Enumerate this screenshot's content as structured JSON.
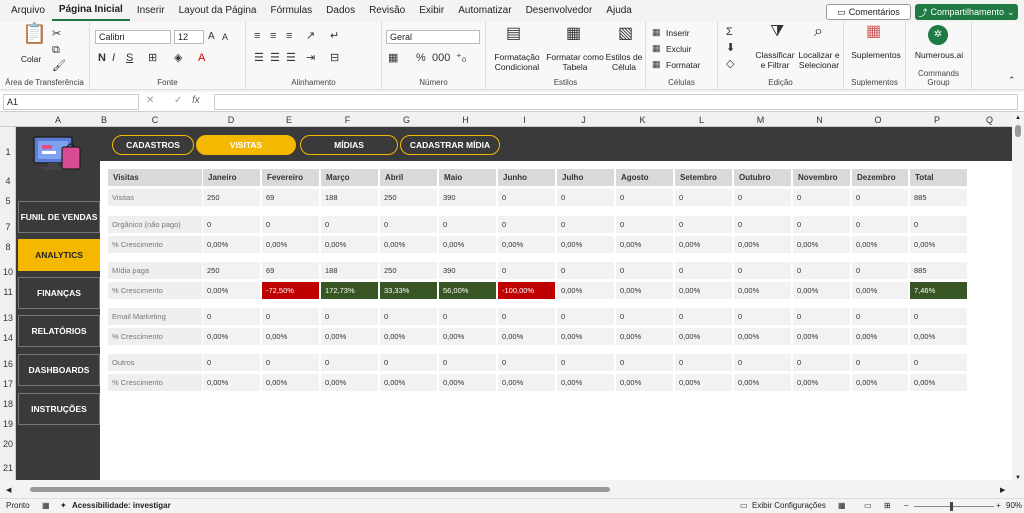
{
  "menu": [
    "Arquivo",
    "Página Inicial",
    "Inserir",
    "Layout da Página",
    "Fórmulas",
    "Dados",
    "Revisão",
    "Exibir",
    "Automatizar",
    "Desenvolvedor",
    "Ajuda"
  ],
  "top_buttons": {
    "comments": "Comentários",
    "share": "Compartilhamento"
  },
  "ribbon": {
    "clipboard": {
      "paste": "Colar",
      "label": "Área de Transferência"
    },
    "font": {
      "name": "Calibri",
      "size": "12",
      "label": "Fonte"
    },
    "alignment": {
      "label": "Alinhamento"
    },
    "number": {
      "format": "Geral",
      "label": "Número"
    },
    "styles": {
      "conditional": "Formatação Condicional",
      "table": "Formatar como Tabela",
      "cell": "Estilos de Célula",
      "label": "Estilos"
    },
    "cells": {
      "insert": "Inserir",
      "delete": "Excluir",
      "format": "Formatar",
      "label": "Células"
    },
    "editing": {
      "sort": "Classificar e Filtrar",
      "find": "Localizar e Selecionar",
      "label": "Edição"
    },
    "addins": {
      "button": "Suplementos",
      "label": "Suplementos"
    },
    "numerous": {
      "button": "Numerous.ai",
      "label": "Commands Group"
    }
  },
  "formula_bar": {
    "name_box": "A1",
    "fx": "fx"
  },
  "columns": [
    "A",
    "B",
    "C",
    "D",
    "E",
    "F",
    "G",
    "H",
    "I",
    "J",
    "K",
    "L",
    "M",
    "N",
    "O",
    "P",
    "Q"
  ],
  "rows": [
    "1",
    "4",
    "5",
    "7",
    "8",
    "10",
    "11",
    "13",
    "14",
    "16",
    "17",
    "18",
    "19",
    "20",
    "21"
  ],
  "top_nav": [
    {
      "label": "CADASTROS",
      "active": false
    },
    {
      "label": "VISITAS",
      "active": true
    },
    {
      "label": "MÍDIAS",
      "active": false
    },
    {
      "label": "CADASTRAR MÍDIA",
      "active": false
    }
  ],
  "side_nav": [
    {
      "label": "FUNIL DE VENDAS",
      "active": false
    },
    {
      "label": "ANALYTICS",
      "active": true
    },
    {
      "label": "FINANÇAS",
      "active": false
    },
    {
      "label": "RELATÓRIOS",
      "active": false
    },
    {
      "label": "DASHBOARDS",
      "active": false
    },
    {
      "label": "INSTRUÇÕES",
      "active": false
    }
  ],
  "table": {
    "headers": [
      "Visitas",
      "Janeiro",
      "Fevereiro",
      "Março",
      "Abril",
      "Maio",
      "Junho",
      "Julho",
      "Agosto",
      "Setembro",
      "Outubro",
      "Novembro",
      "Dezembro",
      "Total"
    ],
    "rows": [
      {
        "label": "Visitas",
        "values": [
          "250",
          "69",
          "188",
          "250",
          "390",
          "0",
          "0",
          "0",
          "0",
          "0",
          "0",
          "0",
          "885"
        ]
      },
      {
        "label": "Orgânico (não pago)",
        "values": [
          "0",
          "0",
          "0",
          "0",
          "0",
          "0",
          "0",
          "0",
          "0",
          "0",
          "0",
          "0",
          "0"
        ]
      },
      {
        "label": "% Crescimento",
        "values": [
          "0,00%",
          "0,00%",
          "0,00%",
          "0,00%",
          "0,00%",
          "0,00%",
          "0,00%",
          "0,00%",
          "0,00%",
          "0,00%",
          "0,00%",
          "0,00%",
          "0,00%"
        ]
      },
      {
        "label": "Mídia paga",
        "values": [
          "250",
          "69",
          "188",
          "250",
          "390",
          "0",
          "0",
          "0",
          "0",
          "0",
          "0",
          "0",
          "885"
        ]
      },
      {
        "label": "% Crescimento",
        "values": [
          "0,00%",
          "-72,50%",
          "172,73%",
          "33,33%",
          "56,00%",
          "-100,00%",
          "0,00%",
          "0,00%",
          "0,00%",
          "0,00%",
          "0,00%",
          "0,00%",
          "7,46%"
        ],
        "styles": [
          "",
          "neg",
          "pos",
          "pos",
          "pos",
          "neg",
          "",
          "",
          "",
          "",
          "",
          "",
          "pos"
        ]
      },
      {
        "label": "Email Marketing",
        "values": [
          "0",
          "0",
          "0",
          "0",
          "0",
          "0",
          "0",
          "0",
          "0",
          "0",
          "0",
          "0",
          "0"
        ]
      },
      {
        "label": "% Crescimento",
        "values": [
          "0,00%",
          "0,00%",
          "0,00%",
          "0,00%",
          "0,00%",
          "0,00%",
          "0,00%",
          "0,00%",
          "0,00%",
          "0,00%",
          "0,00%",
          "0,00%",
          "0,00%"
        ]
      },
      {
        "label": "Outros",
        "values": [
          "0",
          "0",
          "0",
          "0",
          "0",
          "0",
          "0",
          "0",
          "0",
          "0",
          "0",
          "0",
          "0"
        ]
      },
      {
        "label": "% Crescimento",
        "values": [
          "0,00%",
          "0,00%",
          "0,00%",
          "0,00%",
          "0,00%",
          "0,00%",
          "0,00%",
          "0,00%",
          "0,00%",
          "0,00%",
          "0,00%",
          "0,00%",
          "0,00%"
        ]
      }
    ]
  },
  "status": {
    "ready": "Pronto",
    "accessibility": "Acessibilidade: investigar",
    "display_settings": "Exibir Configurações",
    "zoom": "90%"
  }
}
